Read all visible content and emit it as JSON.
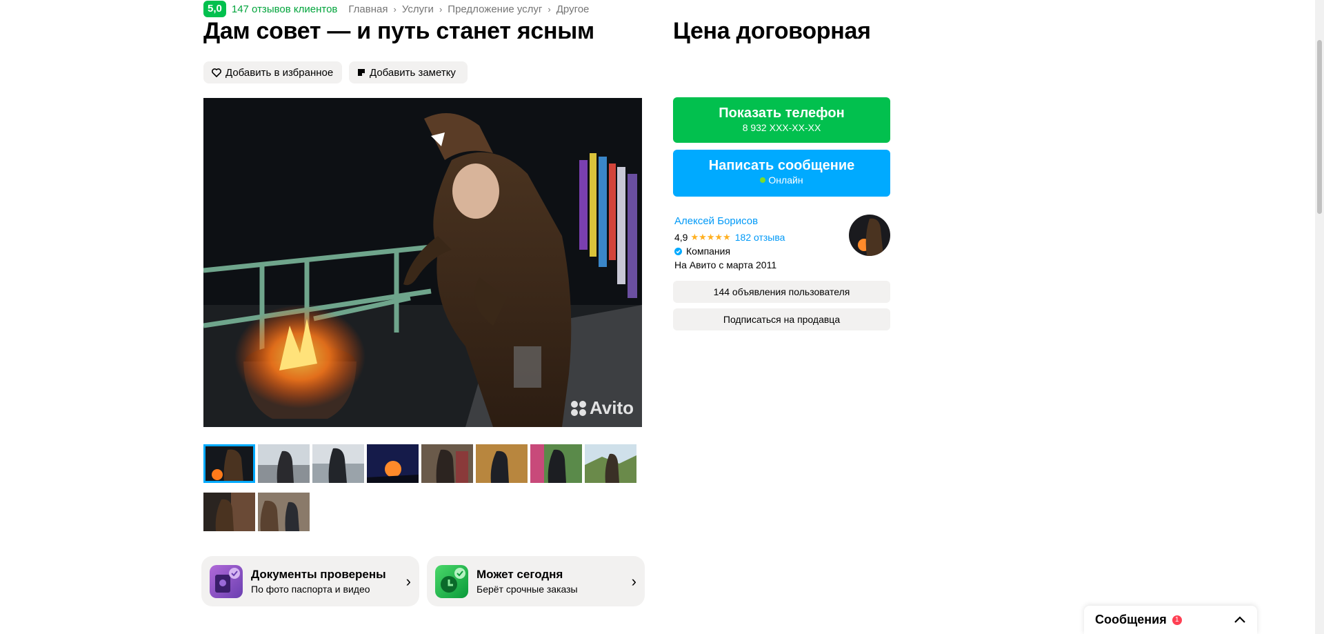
{
  "header": {
    "rating": "5,0",
    "reviews_text": "147 отзывов клиентов",
    "breadcrumbs": [
      "Главная",
      "Услуги",
      "Предложение услуг",
      "Другое"
    ]
  },
  "listing": {
    "title": "Дам совет — и путь станет ясным",
    "price": "Цена договорная",
    "favorite_label": "Добавить в избранное",
    "note_label": "Добавить заметку",
    "photo_watermark": "Avito",
    "thumbnail_count": 10,
    "active_thumbnail": 1
  },
  "features": [
    {
      "title": "Документы проверены",
      "subtitle": "По фото паспорта и видео"
    },
    {
      "title": "Может сегодня",
      "subtitle": "Берёт срочные заказы"
    }
  ],
  "contact": {
    "phone_label": "Показать телефон",
    "phone_masked": "8 932 XXX-XX-XX",
    "message_label": "Написать сообщение",
    "online_status": "Онлайн"
  },
  "seller": {
    "name": "Алексей Борисов",
    "rating": "4,9",
    "stars": 5,
    "reviews": "182 отзыва",
    "type": "Компания",
    "since": "На Авито с марта 2011",
    "ads_button": "144 объявления пользователя",
    "subscribe_button": "Подписаться на продавца"
  },
  "messenger": {
    "label": "Сообщения",
    "unread": "1"
  },
  "colors": {
    "green": "#02c04e",
    "blue": "#00aaff",
    "link_blue": "#0099f7",
    "grey_button": "#f2f1f0",
    "star": "#ffb021",
    "badge_red": "#ff4053"
  }
}
